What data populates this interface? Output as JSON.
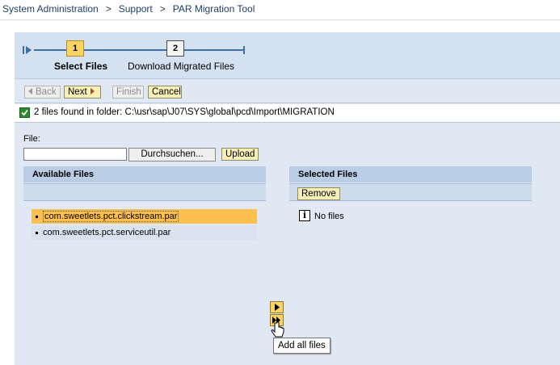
{
  "breadcrumb": [
    "System Administration",
    "Support",
    "PAR Migration Tool"
  ],
  "roadmap": {
    "steps": [
      {
        "number": "1",
        "label": "Select Files",
        "state": "active"
      },
      {
        "number": "2",
        "label": "Download Migrated Files",
        "state": "inactive"
      }
    ]
  },
  "toolbar": {
    "back_label": "Back",
    "next_label": "Next",
    "finish_label": "Finish",
    "cancel_label": "Cancel"
  },
  "message": {
    "icon": "success-check-icon",
    "text": "2 files found in folder: C:\\usr\\sap\\J07\\SYS\\global\\pcd\\Import\\MIGRATION"
  },
  "upload": {
    "file_label": "File:",
    "file_value": "",
    "browse_label": "Durchsuchen...",
    "upload_label": "Upload"
  },
  "available": {
    "title": "Available Files",
    "items": [
      {
        "name": "com.sweetlets.pct.clickstream.par",
        "selected": true
      },
      {
        "name": "com.sweetlets.pct.serviceutil.par",
        "selected": false
      }
    ]
  },
  "selected_files": {
    "title": "Selected Files",
    "remove_label": "Remove",
    "empty_text": "No files"
  },
  "tooltip": "Add all files",
  "colors": {
    "accent_button": "#f7efb6",
    "selected_row": "#fdc04f",
    "panel": "#dfe8f3",
    "header": "#b9cde5"
  }
}
